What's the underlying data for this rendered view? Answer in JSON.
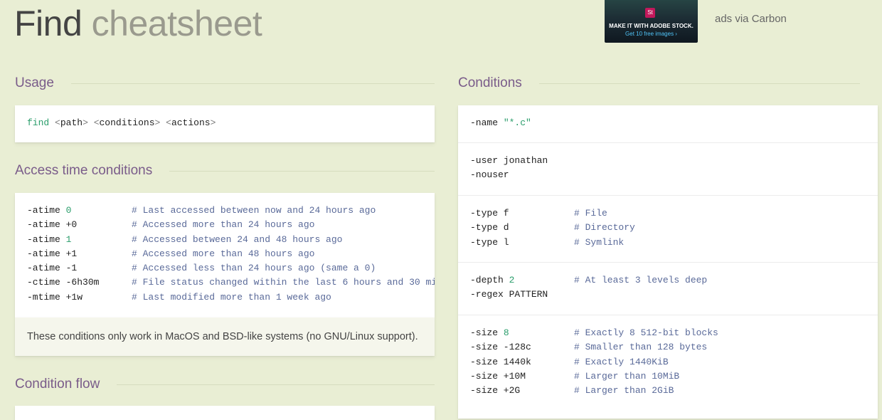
{
  "title": {
    "main": "Find",
    "sub": "cheatsheet"
  },
  "ad": {
    "badge": "St",
    "line1": "MAKE IT WITH ADOBE STOCK.",
    "line2": "Get 10 free images ›",
    "via": "ads via Carbon"
  },
  "usage": {
    "heading": "Usage",
    "cmd": "find",
    "path": "path",
    "conditions": "conditions",
    "actions": "actions"
  },
  "access": {
    "heading": "Access time conditions",
    "rows": [
      {
        "flag": "-atime ",
        "num": "0",
        "rest": "",
        "comment": "# Last accessed between now and 24 hours ago"
      },
      {
        "flag": "-atime +0",
        "num": "",
        "rest": "",
        "comment": "# Accessed more than 24 hours ago"
      },
      {
        "flag": "-atime ",
        "num": "1",
        "rest": "",
        "comment": "# Accessed between 24 and 48 hours ago"
      },
      {
        "flag": "-atime +1",
        "num": "",
        "rest": "",
        "comment": "# Accessed more than 48 hours ago"
      },
      {
        "flag": "-atime -1",
        "num": "",
        "rest": "",
        "comment": "# Accessed less than 24 hours ago (same a 0)"
      },
      {
        "flag": "-ctime -6h30m",
        "num": "",
        "rest": "",
        "comment": "# File status changed within the last 6 hours and 30 mi"
      },
      {
        "flag": "-mtime +1w",
        "num": "",
        "rest": "",
        "comment": "# Last modified more than 1 week ago"
      }
    ],
    "note": "These conditions only work in MacOS and BSD-like systems (no GNU/Linux support)."
  },
  "flow": {
    "heading": "Condition flow"
  },
  "conditions": {
    "heading": "Conditions",
    "name_flag": "-name ",
    "name_val": "\"*.c\"",
    "user1": "-user jonathan",
    "user2": "-nouser",
    "types": [
      {
        "flag": "-type f",
        "comment": "# File"
      },
      {
        "flag": "-type d",
        "comment": "# Directory"
      },
      {
        "flag": "-type l",
        "comment": "# Symlink"
      }
    ],
    "depth_flag": "-depth ",
    "depth_num": "2",
    "depth_comment": "# At least 3 levels deep",
    "regex": "-regex PATTERN",
    "sizes": [
      {
        "flag": "-size ",
        "num": "8",
        "comment": "# Exactly 8 512-bit blocks"
      },
      {
        "flag": "-size -128c",
        "num": "",
        "comment": "# Smaller than 128 bytes"
      },
      {
        "flag": "-size 1440k",
        "num": "",
        "comment": "# Exactly 1440KiB"
      },
      {
        "flag": "-size +10M",
        "num": "",
        "comment": "# Larger than 10MiB"
      },
      {
        "flag": "-size +2G",
        "num": "",
        "comment": "# Larger than 2GiB"
      }
    ]
  }
}
